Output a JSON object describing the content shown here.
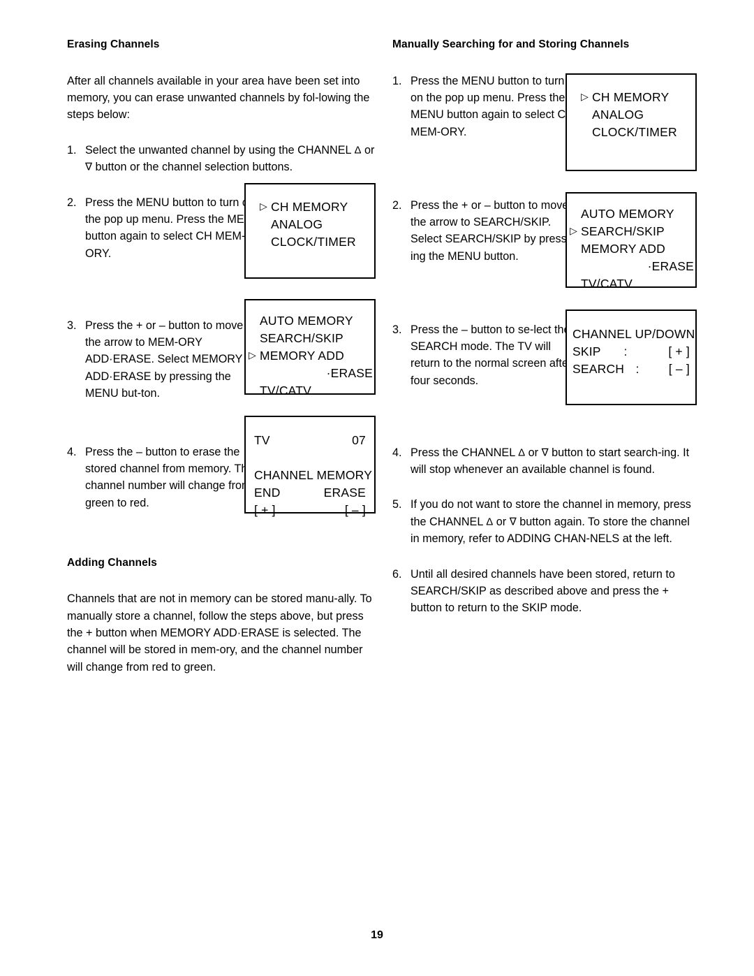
{
  "page": {
    "number": "19"
  },
  "left_column": {
    "heading": "Erasing Channels",
    "intro": "After all channels available in your area have been set into memory, you can erase unwanted channels by fol-lowing the steps below:",
    "steps": [
      {
        "num": "1.",
        "text_before": "Select the unwanted channel by using the CHANNEL ",
        "tri_up": "Δ",
        "mid": " or  ",
        "tri_down": "∇",
        "text_after": " button or the channel selection buttons."
      },
      {
        "num": "2.",
        "text": "Press the MENU button to turn on the pop up menu. Press the MENU button again to select CH MEM-ORY."
      },
      {
        "num": "3.",
        "text": "Press the + or – button to move the arrow to MEM-ORY ADD·ERASE. Select MEMORY ADD·ERASE by pressing the MENU but-ton."
      },
      {
        "num": "4.",
        "text": "Press the – button to erase the stored channel from memory. The channel number will change from green to red."
      }
    ],
    "heading2": "Adding Channels",
    "para2": "Channels that are not in memory can be stored manu-ally. To manually store a channel, follow the steps above, but press the + button when MEMORY ADD·ERASE is selected. The channel will be stored in mem-ory, and the channel number will change from red to green."
  },
  "right_column": {
    "heading": "Manually Searching for and Storing Channels",
    "steps": [
      {
        "num": "1.",
        "text": "Press the MENU button to turn on the pop up menu. Press the MENU button again to select CH MEM-ORY."
      },
      {
        "num": "2.",
        "text": "Press the + or – button to move the arrow to SEARCH/SKIP. Select SEARCH/SKIP by press-ing the MENU button."
      },
      {
        "num": "3.",
        "text": "Press the – button to se-lect the SEARCH mode. The TV will return to the normal screen after four seconds."
      },
      {
        "num": "4.",
        "t1": "Press the CHANNEL ",
        "tri_up": "Δ",
        "t2": " or  ",
        "tri_down": "∇",
        "t3": " button to start search-ing. It will stop whenever an available channel is found."
      },
      {
        "num": "5.",
        "t1": "If you do not want to store the channel in memory, press the CHANNEL ",
        "tri_up": "Δ",
        "t2": " or  ",
        "tri_down": "∇",
        "t3": " button again. To store the channel in memory, refer to ADDING CHAN-NELS at the left."
      },
      {
        "num": "6.",
        "text": "Until all desired channels have been stored, return to SEARCH/SKIP as described above and press the + button to return to the SKIP mode."
      }
    ]
  },
  "osd_boxes": {
    "left_ch_memory": {
      "marker": "▷",
      "line1": "CH MEMORY",
      "line2": "ANALOG",
      "line3": "CLOCK/TIMER"
    },
    "left_memory_add": {
      "marker": "▷",
      "line1": "AUTO MEMORY",
      "line2": "SEARCH/SKIP",
      "line3": "MEMORY ADD",
      "line4": "·ERASE",
      "line5": "TV/CATV"
    },
    "left_channel_memory": {
      "tv_label": "TV",
      "channel_number": "07",
      "title": "CHANNEL MEMORY",
      "end_label": "END",
      "erase_label": "ERASE",
      "plus_key": "[ + ]",
      "minus_key": "[ – ]"
    },
    "right_ch_memory": {
      "marker": "▷",
      "line1": "CH MEMORY",
      "line2": "ANALOG",
      "line3": "CLOCK/TIMER"
    },
    "right_search_skip": {
      "marker": "▷",
      "line1": "AUTO MEMORY",
      "line2": "SEARCH/SKIP",
      "line3": "MEMORY ADD",
      "line4": "·ERASE",
      "line5": "TV/CATV"
    },
    "right_channel_updown": {
      "title": "CHANNEL UP/DOWN",
      "skip_label": "SKIP",
      "skip_colon": ":",
      "skip_key": "[ + ]",
      "search_label": "SEARCH",
      "search_colon": ":",
      "search_key": "[ – ]"
    }
  }
}
